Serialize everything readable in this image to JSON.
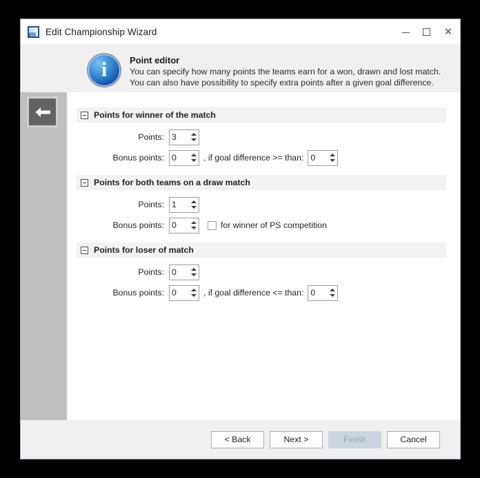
{
  "window": {
    "title": "Edit Championship Wizard",
    "app_icon": "application-icon",
    "controls": {
      "minimize": "minimize-icon",
      "maximize": "maximize-icon",
      "close": "close-icon"
    }
  },
  "header": {
    "icon": "info-icon",
    "title": "Point editor",
    "description": "You can specify how many points the teams earn for a won, drawn and lost match. You can also have possibility to specify extra points after a given goal difference."
  },
  "sidebar": {
    "back_button": "back-arrow-icon"
  },
  "groups": [
    {
      "title": "Points for winner of the match",
      "collapse_icon": "collapse-minus-icon",
      "points_label": "Points:",
      "points_value": "3",
      "bonus_label": "Bonus points:",
      "bonus_value": "0",
      "condition_text": ", if goal difference >= than:",
      "condition_value": "0"
    },
    {
      "title": "Points for both teams on a draw match",
      "collapse_icon": "collapse-minus-icon",
      "points_label": "Points:",
      "points_value": "1",
      "bonus_label": "Bonus points:",
      "bonus_value": "0",
      "checkbox_label": "for winner of PS competition",
      "checkbox_checked": false
    },
    {
      "title": "Points for loser of match",
      "collapse_icon": "collapse-minus-icon",
      "points_label": "Points:",
      "points_value": "0",
      "bonus_label": "Bonus points:",
      "bonus_value": "0",
      "condition_text": ", if goal difference <= than:",
      "condition_value": "0"
    }
  ],
  "footer": {
    "back": "< Back",
    "next": "Next >",
    "finish": "Finish",
    "cancel": "Cancel",
    "finish_disabled": true
  },
  "colors": {
    "window_border": "#a8b4c0",
    "sidebar": "#c0c0c0",
    "header_band": "#f0f0f0",
    "group_header": "#f2f2f2",
    "disabled_button": "#ccd5de",
    "info_icon_blue": "#1256a8"
  }
}
